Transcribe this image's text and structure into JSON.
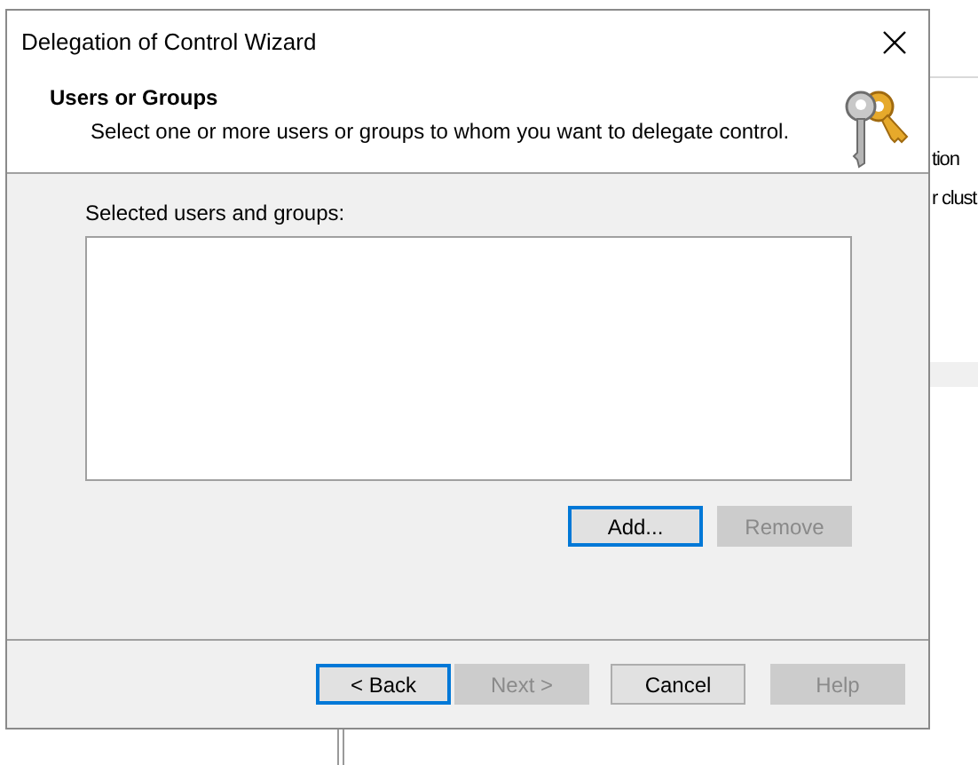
{
  "background_window": {
    "texts": [
      "tion",
      "r clust"
    ]
  },
  "dialog": {
    "title": "Delegation of Control Wizard",
    "header": {
      "title": "Users or Groups",
      "subtitle": "Select one or more users or groups to whom you want to delegate control."
    },
    "list": {
      "label": "Selected users and groups:"
    },
    "list_buttons": [
      {
        "label": "Add...",
        "disabled": false,
        "focused": true
      },
      {
        "label": "Remove",
        "disabled": true,
        "focused": false
      }
    ],
    "footer_buttons": [
      {
        "label": "< Back",
        "disabled": false,
        "focused": true
      },
      {
        "label": "Next >",
        "disabled": true,
        "focused": false
      },
      {
        "label": "Cancel",
        "disabled": false,
        "focused": false
      },
      {
        "label": "Help",
        "disabled": true,
        "focused": false
      }
    ]
  }
}
